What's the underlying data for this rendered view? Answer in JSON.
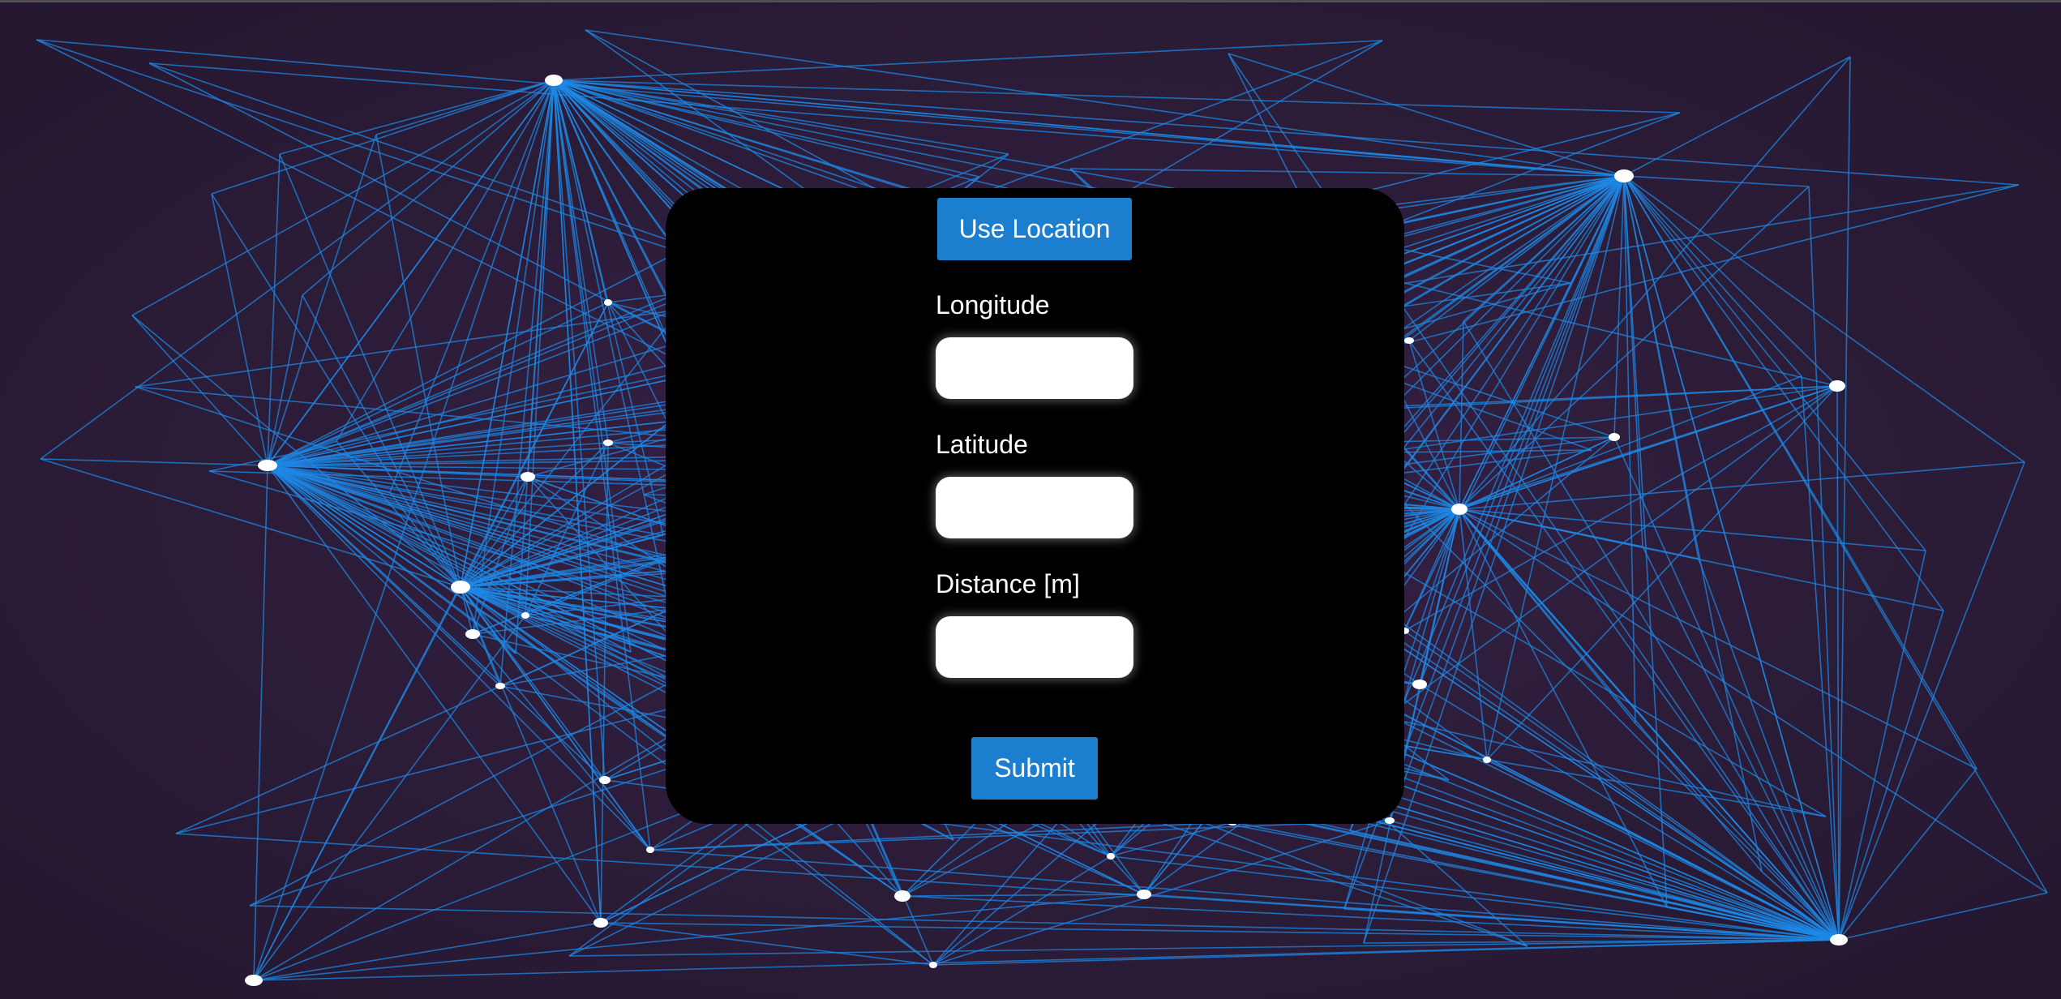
{
  "background": {
    "color_top": "#3a2148",
    "color_edge": "#24172f",
    "line_color": "#1e88e5",
    "node_color": "#ffffff"
  },
  "form": {
    "use_location_label": "Use Location",
    "longitude_label": "Longitude",
    "longitude_value": "",
    "latitude_label": "Latitude",
    "latitude_value": "",
    "distance_label": "Distance [m]",
    "distance_value": "",
    "submit_label": "Submit",
    "button_color": "#1b7ecf"
  }
}
